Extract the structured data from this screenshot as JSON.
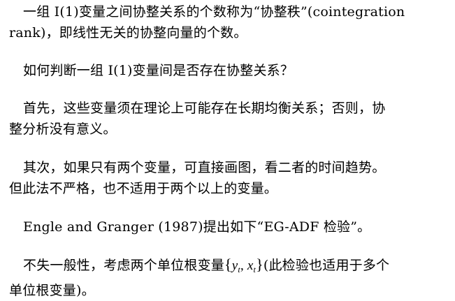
{
  "paragraphs": [
    {
      "id": "p1",
      "lines": [
        "一组 I(1)变量之间协整关系的个数称为“协整秩”(cointegration",
        "rank)，即线性无关的协整向量的个数。"
      ]
    },
    {
      "id": "p2",
      "lines": [
        "如何判断一组 I(1)变量间是否存在协整关系？"
      ]
    },
    {
      "id": "p3",
      "lines": [
        "首先，这些变量须在理论上可能存在长期均衡关系；否则，协",
        "整分析没有意义。"
      ]
    },
    {
      "id": "p4",
      "lines": [
        "其次，如果只有两个变量，可直接画图，看二者的时间趋势。",
        "但此法不严格，也不适用于两个以上的变量。"
      ]
    },
    {
      "id": "p5",
      "lines": [
        "Engle and Granger (1987)提出如下“EG-ADF 检验”。"
      ]
    },
    {
      "id": "p6",
      "line1_before": "不失一般性，考虑两个单位根变量",
      "math": {
        "open_brace": "{",
        "y": "y",
        "y_sub": "t",
        "comma": ", ",
        "x": "x",
        "x_sub": "t",
        "close_brace": "}"
      },
      "line1_after": "(此检验也适用于多个",
      "line2": "单位根变量)。"
    }
  ]
}
